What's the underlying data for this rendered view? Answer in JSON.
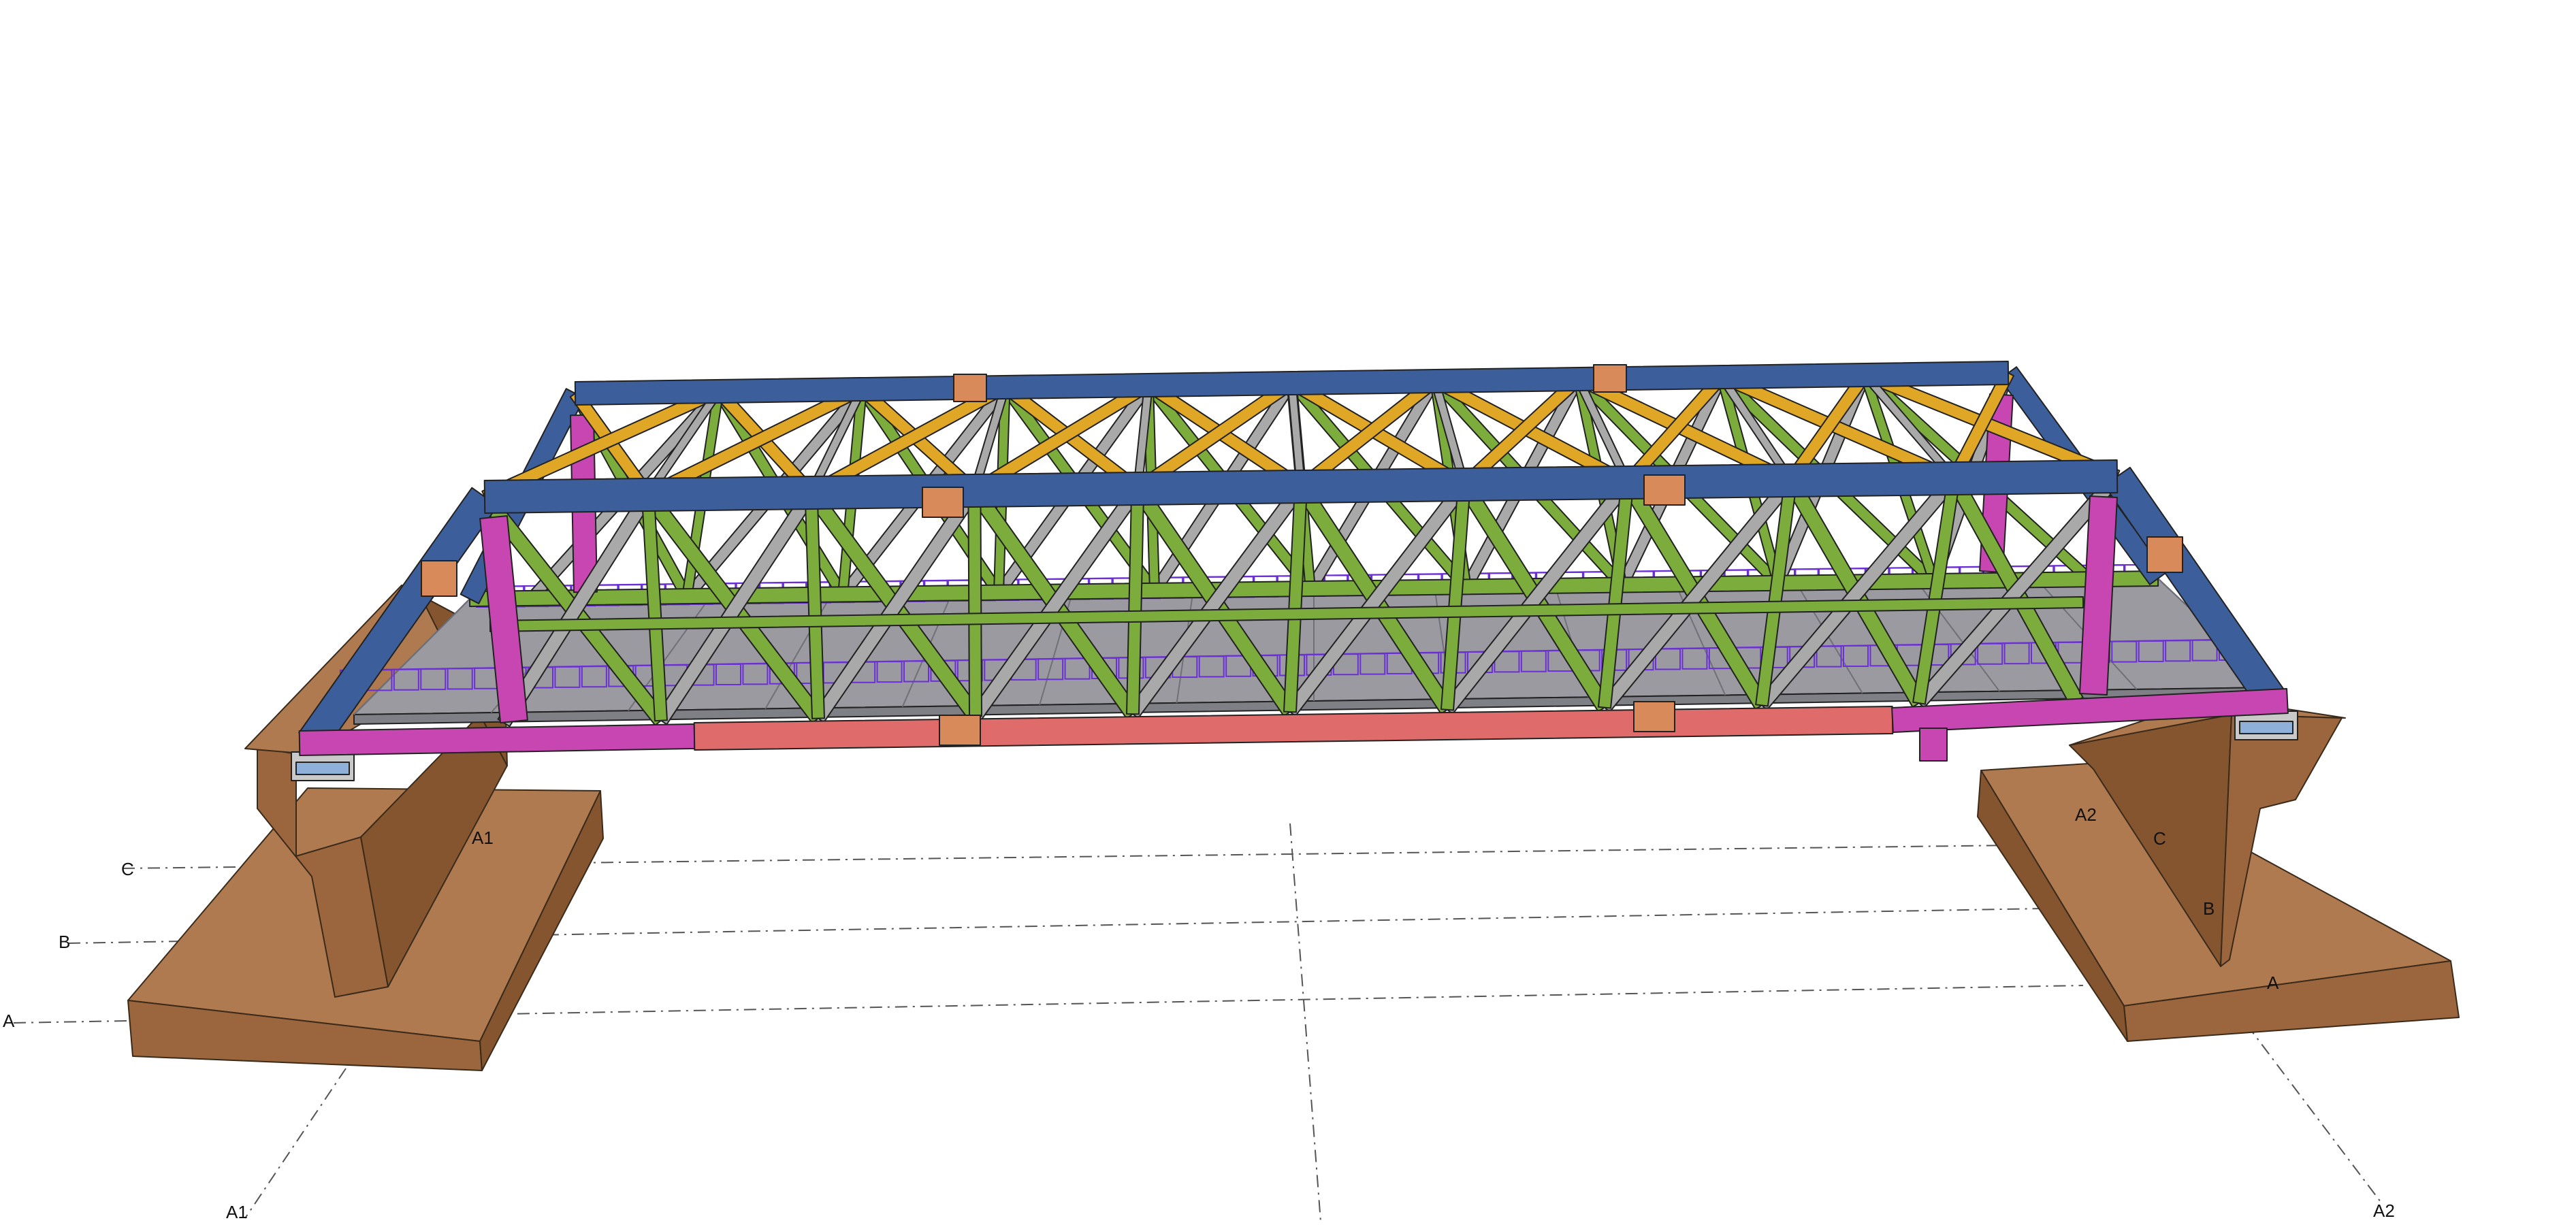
{
  "grid_labels": {
    "left_c": "C",
    "left_b": "B",
    "left_a": "A",
    "left_a1": "A1",
    "bottom_a1": "A1",
    "right_a2": "A2",
    "right_c": "C",
    "right_b": "B",
    "right_a": "A",
    "bottom_a2": "A2"
  },
  "colors": {
    "background": "#ffffff",
    "concrete_top": "#b07a50",
    "concrete_front": "#9b663d",
    "concrete_side": "#84552f",
    "top_chord": "#3c5f9b",
    "top_chord_dark": "#2b4675",
    "upper_bracing": "#e0a726",
    "web_member": "#7cad3c",
    "secondary_member": "#a9a9a9",
    "end_post": "#c846b2",
    "bottom_chord": "#e06b6b",
    "deck": "#9a9aa0",
    "railing": "#6b2fd6",
    "splice": "#d98a5a"
  }
}
